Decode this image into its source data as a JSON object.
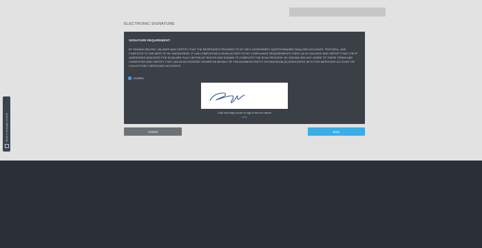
{
  "section": {
    "title": "ELECTRONIC SIGNATURE"
  },
  "panel": {
    "heading": "SIGNATURE REQUIREMENT:",
    "text": "BY SIGNING BELOW I VALIDATE AND CERTIFY THAT THE RESPONSES PROVIDED TO MY SELF ASSESSMENT QUESTIONNAIRE (SAQ) ARE ACCURATE, TRUTHFUL, AND COMPLETE TO THE BEST OF MY KNOWLEDGE. IF I AM COMPLETING A SCAN AS PART OF MY COMPLIANCE REQUIREMENTS THEN I ALSO VALIDATE AND CERTIFY THAT THE IP ADDRESSES INDICATED FOR SCAN ARE FULLY WITHIN MY RIGHTS AND DOMAIN TO COMPLETE THE SCAN PROCESS. BY SIGNING BELOW I AGREE TO THESE TERMS AND CONDITIONS AND CERTIFY THAT I AM AN AUTHORIZED SIGNER ON BEHALF OF THE BUSINESS ENTITY OR INDIVIDUAL(S) ASSOCIATED WITH THIS MERCHANT ACCOUNT OR COLLECTIVELY MERCHANT ACCOUNTS.",
    "agree_label": "I AGREE",
    "agree_checked": true,
    "sign_instruction": "Click and drag mouse to sign in the box above",
    "clear_label": "Clear"
  },
  "buttons": {
    "cancel": "Cancel",
    "save": "Save"
  },
  "feedback_tab": {
    "label": "Send a message (online)"
  },
  "colors": {
    "page_background": "#e2e2e2",
    "panel_background": "#3b3f46",
    "footer_background": "#2b2f36",
    "cancel_button": "#6e7277",
    "save_button": "#39aee8",
    "checkbox": "#3d8ed2",
    "signature_ink": "#2f4fa0"
  }
}
